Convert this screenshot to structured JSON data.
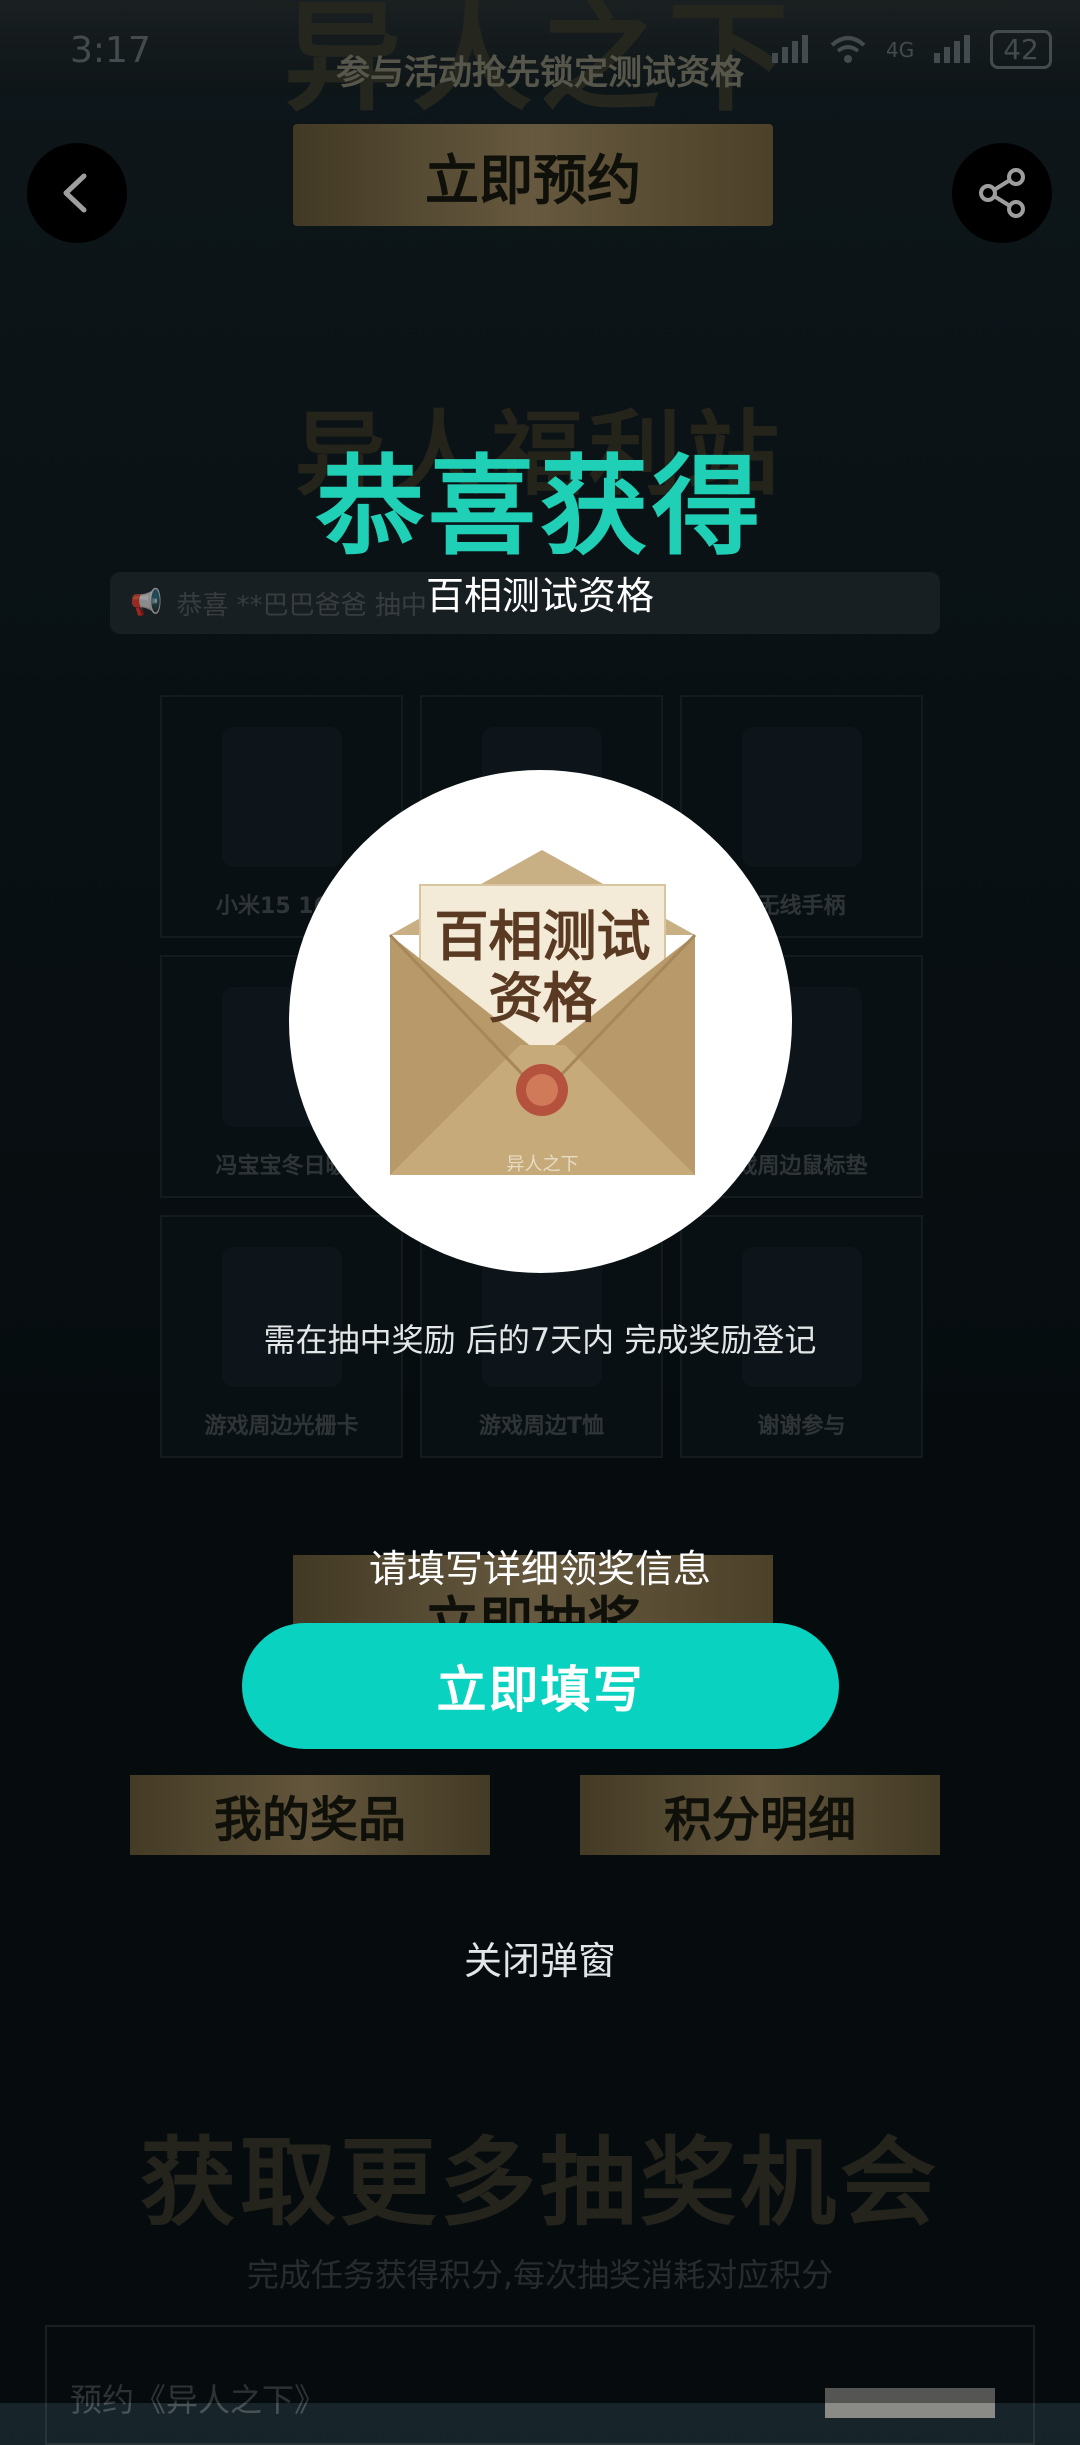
{
  "status_bar": {
    "time": "3:17",
    "network": "4G",
    "battery": "42"
  },
  "header": {
    "subtitle": "参与活动抢先锁定测试资格",
    "reserve_label": "立即预约"
  },
  "welfare": {
    "title": "异人福利站",
    "ticker": "恭喜 **巴巴爸爸 抽中",
    "prizes": [
      {
        "label": "小米15 16G"
      },
      {
        "label": ""
      },
      {
        "label": "无线手柄"
      },
      {
        "label": "冯宝宝冬日暖"
      },
      {
        "label": ""
      },
      {
        "label": "戏周边鼠标垫"
      },
      {
        "label": "游戏周边光栅卡"
      },
      {
        "label": "游戏周边T恤"
      },
      {
        "label": "谢谢参与"
      }
    ],
    "draw_label": "立即抽奖",
    "my_prizes_label": "我的奖品",
    "points_label": "积分明细"
  },
  "more_chances": {
    "title": "获取更多抽奖机会",
    "subtitle": "完成任务获得积分,每次抽奖消耗对应积分",
    "task_text": "预约《异人之下》"
  },
  "popup": {
    "title": "恭喜获得",
    "prize_name": "百相测试资格",
    "prize_image_text_line1": "百相测试",
    "prize_image_text_line2": "资格",
    "prize_image_footer": "异人之下",
    "note": "需在抽中奖励 后的7天内 完成奖励登记",
    "fill_hint": "请填写详细领奖信息",
    "fill_button": "立即填写",
    "close_label": "关闭弹窗"
  },
  "colors": {
    "accent": "#20d0b6",
    "button": "#0ad2c0",
    "gold": "#a59066"
  },
  "icons": {
    "back": "chevron-left-icon",
    "share": "share-icon"
  }
}
